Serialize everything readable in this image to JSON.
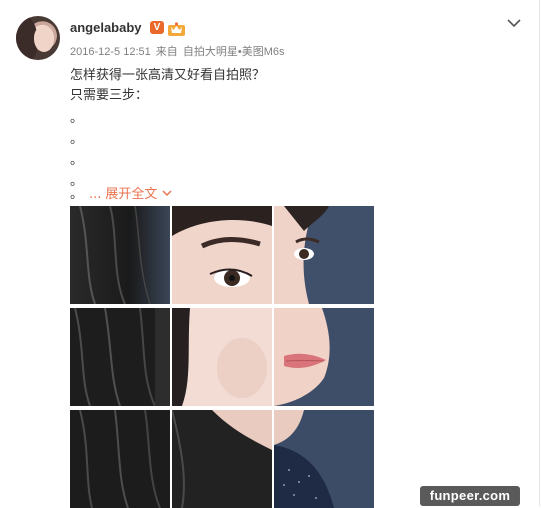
{
  "post": {
    "username": "angelababy",
    "verified_badge": "V",
    "timestamp": "2016-12-5 12:51",
    "source_prefix": "来自",
    "source_device": "自拍大明星•美图M6s",
    "line1": "怎样获得一张高清又好看自拍照？",
    "line2": "只需要三步：",
    "bullets": [
      "。",
      "。",
      "。",
      "。",
      "。"
    ],
    "expand_dots": "...",
    "expand_label": "展开全文"
  },
  "icons": {
    "menu": "chevron-down-icon",
    "vip": "vip-crown-icon",
    "expand": "chevron-down-icon"
  },
  "colors": {
    "accent": "#eb7350",
    "verified": "#e8692a",
    "meta_text": "#808080",
    "photo_bg": "#3b4a63"
  },
  "watermark": "funpeer.com"
}
